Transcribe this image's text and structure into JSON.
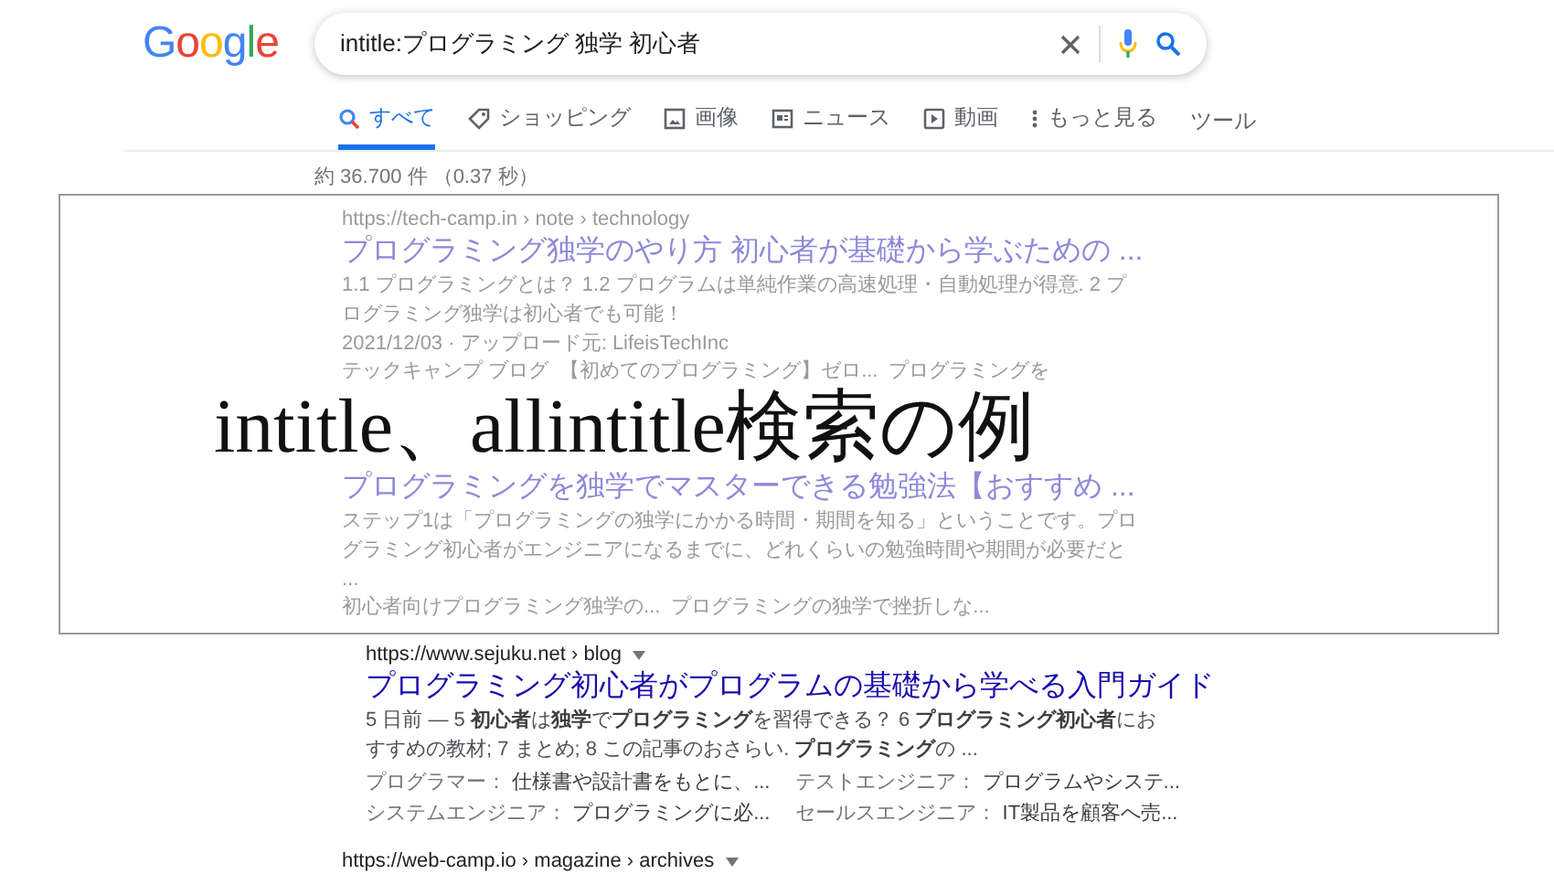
{
  "header": {
    "logo": "Google",
    "query": "intitle:プログラミング 独学 初心者"
  },
  "tabs": [
    {
      "label": "すべて",
      "kind": "search",
      "selected": true
    },
    {
      "label": "ショッピング",
      "kind": "tag",
      "selected": false
    },
    {
      "label": "画像",
      "kind": "image",
      "selected": false
    },
    {
      "label": "ニュース",
      "kind": "news",
      "selected": false
    },
    {
      "label": "動画",
      "kind": "video",
      "selected": false
    },
    {
      "label": "もっと見る",
      "kind": "more",
      "selected": false
    }
  ],
  "tools": "ツール",
  "result_stats": "約 36.700 件 （0.37 秒）",
  "overlay": {
    "caption": "intitle、allintitle検索の例",
    "results_above": [
      {
        "url": "https://tech-camp.in › note › technology",
        "title": "プログラミング独学のやり方 初心者が基礎から学ぶための ...",
        "snippet": "1.1 プログラミングとは？ 1.2 プログラムは単純作業の高速処理・自動処理が得意. 2 プログラミング独学は初心者でも可能！",
        "date": "2021/12/03 · アップロード元: LifeisTechInc",
        "links": [
          "テックキャンプ ブログ",
          "【初めてのプログラミング】ゼロ...",
          "プログラミングを"
        ]
      }
    ],
    "results_below": [
      {
        "title": "プログラミングを独学でマスターできる勉強法【おすすめ ...",
        "snippet": "ステップ1は「プログラミングの独学にかかる時間・期間を知る」ということです。プログラミング初心者がエンジニアになるまでに、どれくらいの勉強時間や期間が必要だと ...",
        "links": [
          "初心者向けプログラミング独学の...",
          "プログラミングの独学で挫折しな..."
        ]
      }
    ]
  },
  "results": [
    {
      "url": "https://www.sejuku.net › blog",
      "title": "プログラミング初心者がプログラムの基礎から学べる入門ガイド",
      "snippet": "5 日前 — 5 **初心者**は**独学**で**プログラミング**を習得できる？ 6 **プログラミング初心者**におすすめの教材; 7 まとめ; 8 この記事のおさらい. **プログラミング**の ...",
      "sitelinks": [
        "プログラマー： **仕様書や設計書をもとに、...**",
        "テストエンジニア： **プログラムやシステ...**",
        "システムエンジニア： **プログラミングに必...**",
        "セールスエンジニア： **IT製品を顧客へ売...**"
      ]
    },
    {
      "url": "https://web-camp.io › magazine › archives"
    }
  ]
}
